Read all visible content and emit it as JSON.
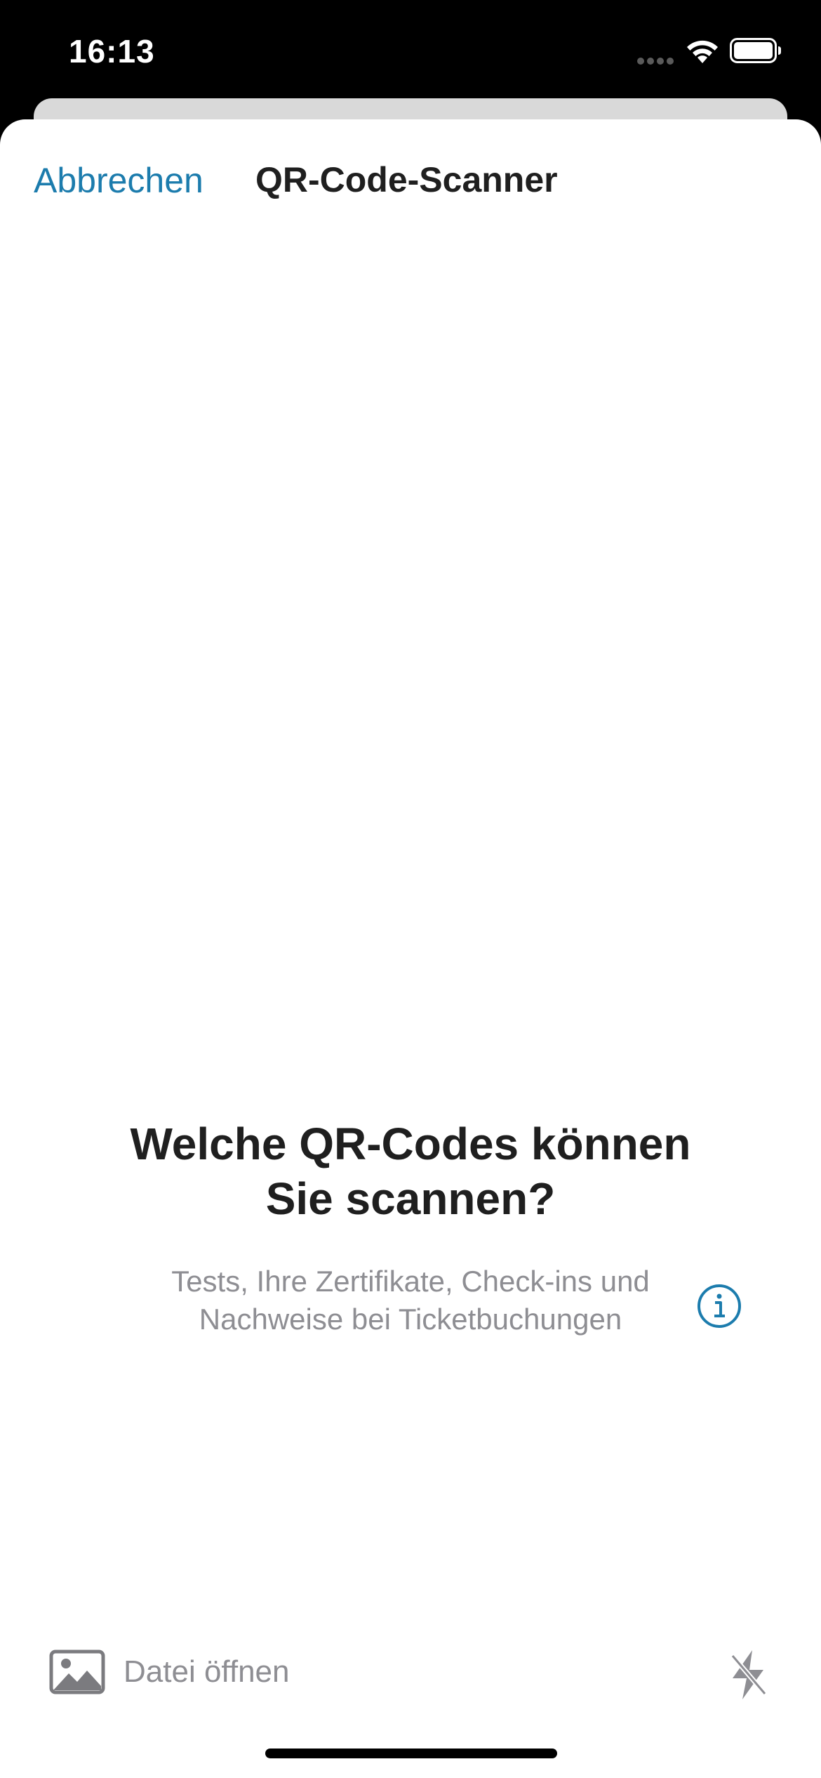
{
  "status_bar": {
    "time": "16:13",
    "icons": [
      "signal-dots-icon",
      "wifi-icon",
      "battery-icon"
    ]
  },
  "nav": {
    "cancel_label": "Abbrechen",
    "title": "QR-Code-Scanner"
  },
  "content": {
    "headline_line1": "Welche QR-Codes können",
    "headline_line2": "Sie scannen?",
    "subtext_line1": "Tests, Ihre Zertifikate, Check-ins und",
    "subtext_line2": "Nachweise bei Ticketbuchungen",
    "info_icon": "info-icon"
  },
  "toolbar": {
    "open_file_label": "Datei öffnen",
    "open_file_icon": "image-icon",
    "flash_icon": "flash-off-icon"
  },
  "colors": {
    "accent": "#1c7cad",
    "title_text": "#1f1f1f",
    "secondary_text": "#8e8e93",
    "status_bar_bg": "#000000",
    "sheet_bg": "#ffffff"
  }
}
